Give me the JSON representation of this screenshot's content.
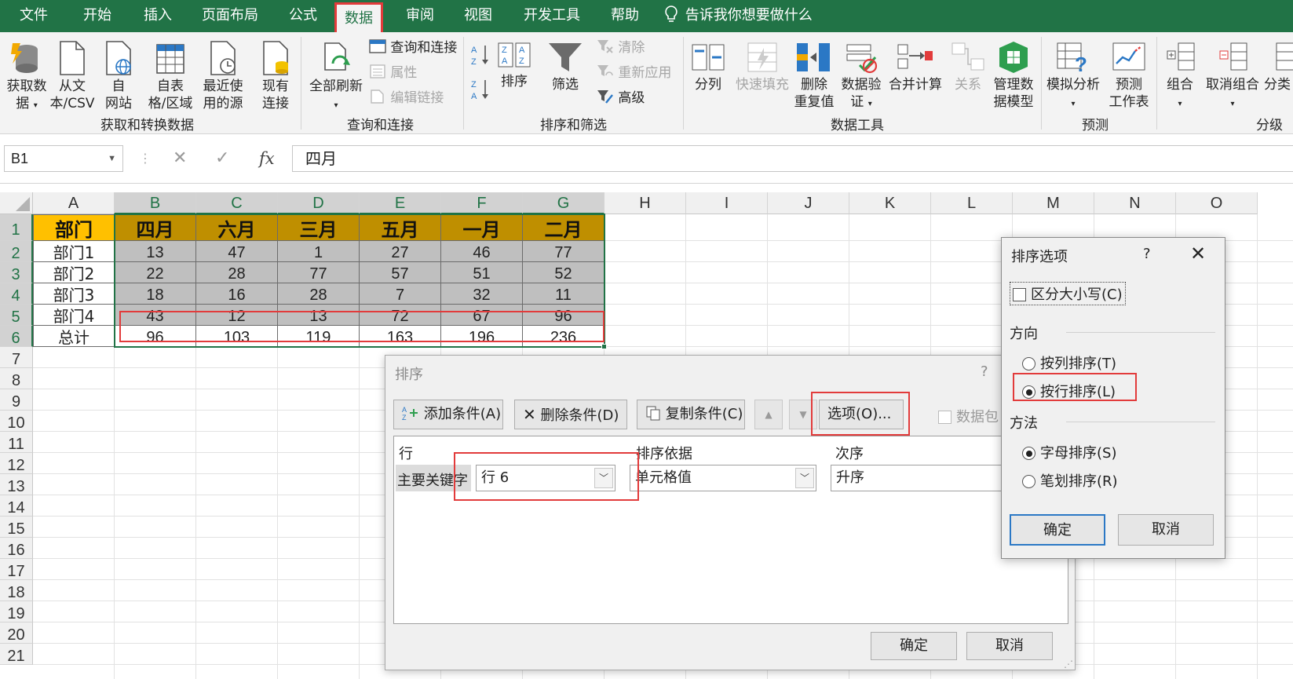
{
  "tabs": [
    "文件",
    "开始",
    "插入",
    "页面布局",
    "公式",
    "数据",
    "审阅",
    "视图",
    "开发工具",
    "帮助"
  ],
  "active_tab": "数据",
  "tell_me": "告诉我你想要做什么",
  "ribbon": {
    "get_data": "获取数据",
    "get_data_2": "据",
    "from_csv": "从文本/CSV",
    "from_csv_1": "从文",
    "from_csv_2": "本/CSV",
    "from_web_1": "自",
    "from_web_2": "网站",
    "from_table_1": "自表",
    "from_table_2": "格/区域",
    "recent_1": "最近使",
    "recent_2": "用的源",
    "existing_1": "现有",
    "existing_2": "连接",
    "get_data_1": "获取数",
    "group_get": "获取和转换数据",
    "refresh_all": "全部刷新",
    "queries_conn": "查询和连接",
    "properties": "属性",
    "edit_links": "编辑链接",
    "group_queries": "查询和连接",
    "sort": "排序",
    "filter": "筛选",
    "clear": "清除",
    "reapply": "重新应用",
    "advanced": "高级",
    "group_sort": "排序和筛选",
    "text_to_col": "分列",
    "flash_fill": "快速填充",
    "remove_dup_1": "删除",
    "remove_dup_2": "重复值",
    "validation_1": "数据验",
    "validation_2": "证",
    "consolidate": "合并计算",
    "relations": "关系",
    "model_1": "管理数",
    "model_2": "据模型",
    "group_tools": "数据工具",
    "whatif": "模拟分析",
    "forecast_1": "预测",
    "forecast_2": "工作表",
    "group_forecast": "预测",
    "group_btn": "组合",
    "ungroup": "取消组合",
    "subtotal": "分类",
    "group_outline": "分级"
  },
  "formula_bar": {
    "name_box": "B1",
    "formula": "四月"
  },
  "columns": [
    "A",
    "B",
    "C",
    "D",
    "E",
    "F",
    "G",
    "H",
    "I",
    "J",
    "K",
    "L",
    "M",
    "N",
    "O"
  ],
  "rows": [
    "1",
    "2",
    "3",
    "4",
    "5",
    "6",
    "7",
    "8",
    "9",
    "10",
    "11",
    "12",
    "13",
    "14",
    "15",
    "16",
    "17",
    "18",
    "19",
    "20",
    "21"
  ],
  "sheet": {
    "header": [
      "部门",
      "四月",
      "六月",
      "三月",
      "五月",
      "一月",
      "二月"
    ],
    "body": [
      [
        "部门1",
        "13",
        "47",
        "1",
        "27",
        "46",
        "77"
      ],
      [
        "部门2",
        "22",
        "28",
        "77",
        "57",
        "51",
        "52"
      ],
      [
        "部门3",
        "18",
        "16",
        "28",
        "7",
        "32",
        "11"
      ],
      [
        "部门4",
        "43",
        "12",
        "13",
        "72",
        "67",
        "96"
      ],
      [
        "总计",
        "96",
        "103",
        "119",
        "163",
        "196",
        "236"
      ]
    ]
  },
  "colors": {
    "excel_green": "#217346",
    "header_a": "#ffc000",
    "header_b": "#bf8f00",
    "body_gray": "#bfbfbf",
    "highlight_red": "#e23b3b"
  },
  "sort_dialog": {
    "title": "排序",
    "help": "?",
    "add": "添加条件(A)",
    "delete": "删除条件(D)",
    "copy": "复制条件(C)",
    "options": "选项(O)...",
    "has_header": "数据包",
    "col_row": "行",
    "col_sort_on": "排序依据",
    "col_order": "次序",
    "primary_key": "主要关键字",
    "key_value": "行 6",
    "sort_on_value": "单元格值",
    "order_value": "升序",
    "ok": "确定",
    "cancel": "取消"
  },
  "options_dialog": {
    "title": "排序选项",
    "help": "?",
    "case_sensitive": "区分大小写(C)",
    "direction": "方向",
    "by_col": "按列排序(T)",
    "by_row": "按行排序(L)",
    "method": "方法",
    "alpha": "字母排序(S)",
    "stroke": "笔划排序(R)",
    "ok": "确定",
    "cancel": "取消"
  },
  "icons": [
    "lightbulb-icon",
    "funnel-icon",
    "sort-az-icon",
    "sort-za-icon",
    "fx-icon",
    "close-icon",
    "chevron-down-icon"
  ]
}
